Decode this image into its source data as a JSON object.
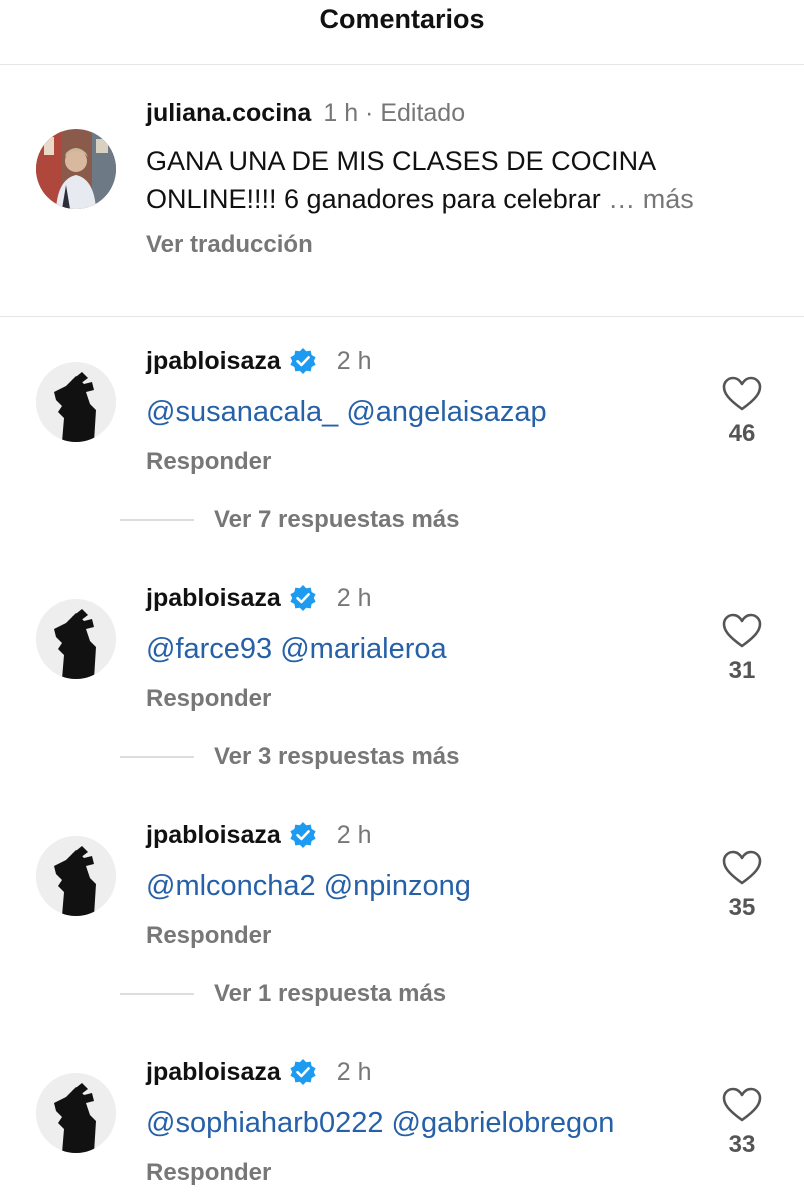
{
  "header": {
    "title": "Comentarios"
  },
  "post": {
    "username": "juliana.cocina",
    "meta": "1 h · Editado",
    "caption": "GANA UNA DE MIS CLASES DE COCINA ONLINE!!!! 6 ganadores para celebrar",
    "more_label": "… más",
    "translate_label": "Ver traducción"
  },
  "comments": [
    {
      "username": "jpabloisaza",
      "time": "2 h",
      "mentions": "@susanacala_ @angelaisazap",
      "reply_label": "Responder",
      "likes": "46",
      "view_replies": "Ver 7 respuestas más"
    },
    {
      "username": "jpabloisaza",
      "time": "2 h",
      "mentions": "@farce93 @marialeroa",
      "reply_label": "Responder",
      "likes": "31",
      "view_replies": "Ver 3 respuestas más"
    },
    {
      "username": "jpabloisaza",
      "time": "2 h",
      "mentions": "@mlconcha2 @npinzong",
      "reply_label": "Responder",
      "likes": "35",
      "view_replies": "Ver 1 respuesta más"
    },
    {
      "username": "jpabloisaza",
      "time": "2 h",
      "mentions": "@sophiaharb0222 @gabrielobregon",
      "reply_label": "Responder",
      "likes": "33"
    }
  ],
  "colors": {
    "mention": "#2661a8",
    "verified": "#1d9bf0",
    "muted": "#777777"
  },
  "icons": {
    "like": "heart-outline-icon",
    "verified": "verified-badge-icon"
  }
}
